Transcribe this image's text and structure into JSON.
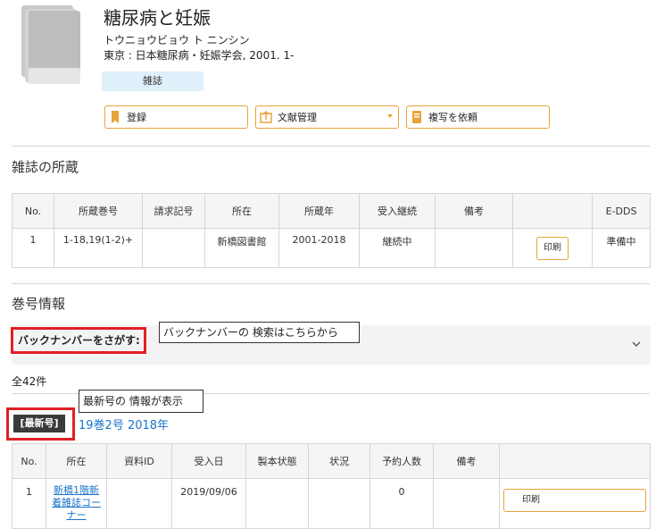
{
  "record": {
    "title": "糖尿病と妊娠",
    "kana": "トウニョウビョウ ト ニンシン",
    "publisher": "東京 : 日本糖尿病・妊娠学会, 2001. 1-",
    "type_badge": "雑誌"
  },
  "actions": {
    "register": "登録",
    "document_mgmt": "文献管理",
    "copy_request": "複写を依頼"
  },
  "holdings": {
    "section_title": "雑誌の所蔵",
    "headers": [
      "No.",
      "所蔵巻号",
      "請求記号",
      "所在",
      "所蔵年",
      "受入継続",
      "備考",
      "",
      "E-DDS"
    ],
    "rows": [
      {
        "no": "1",
        "volumes": "1-18,19(1-2)+",
        "call_no": "",
        "location": "新橋図書館",
        "years": "2001-2018",
        "continuation": "継続中",
        "note": "",
        "print": "印刷",
        "edds": "準備中"
      }
    ]
  },
  "issues": {
    "section_title": "巻号情報",
    "backnumber_label": "バックナンバーをさがす:",
    "backnumber_callout": "バックナンバーの 検索はこちらから",
    "total": "全42件",
    "latest_callout": "最新号の 情報が表示",
    "latest_badge": "[最新号]",
    "latest_issue": "19巻2号 2018年",
    "headers": [
      "No.",
      "所在",
      "資料ID",
      "受入日",
      "製本状態",
      "状況",
      "予約人数",
      "備考",
      ""
    ],
    "rows": [
      {
        "no": "1",
        "location": "新橋1階新着雑誌コーナー",
        "material_id": "",
        "received": "2019/09/06",
        "binding": "",
        "status": "",
        "reservations": "0",
        "note": "",
        "print": "印刷"
      }
    ]
  },
  "colors": {
    "accent": "#e7a43a",
    "link": "#1a73c9",
    "highlight": "#e21f26",
    "badge_bg": "#dff0fa"
  }
}
